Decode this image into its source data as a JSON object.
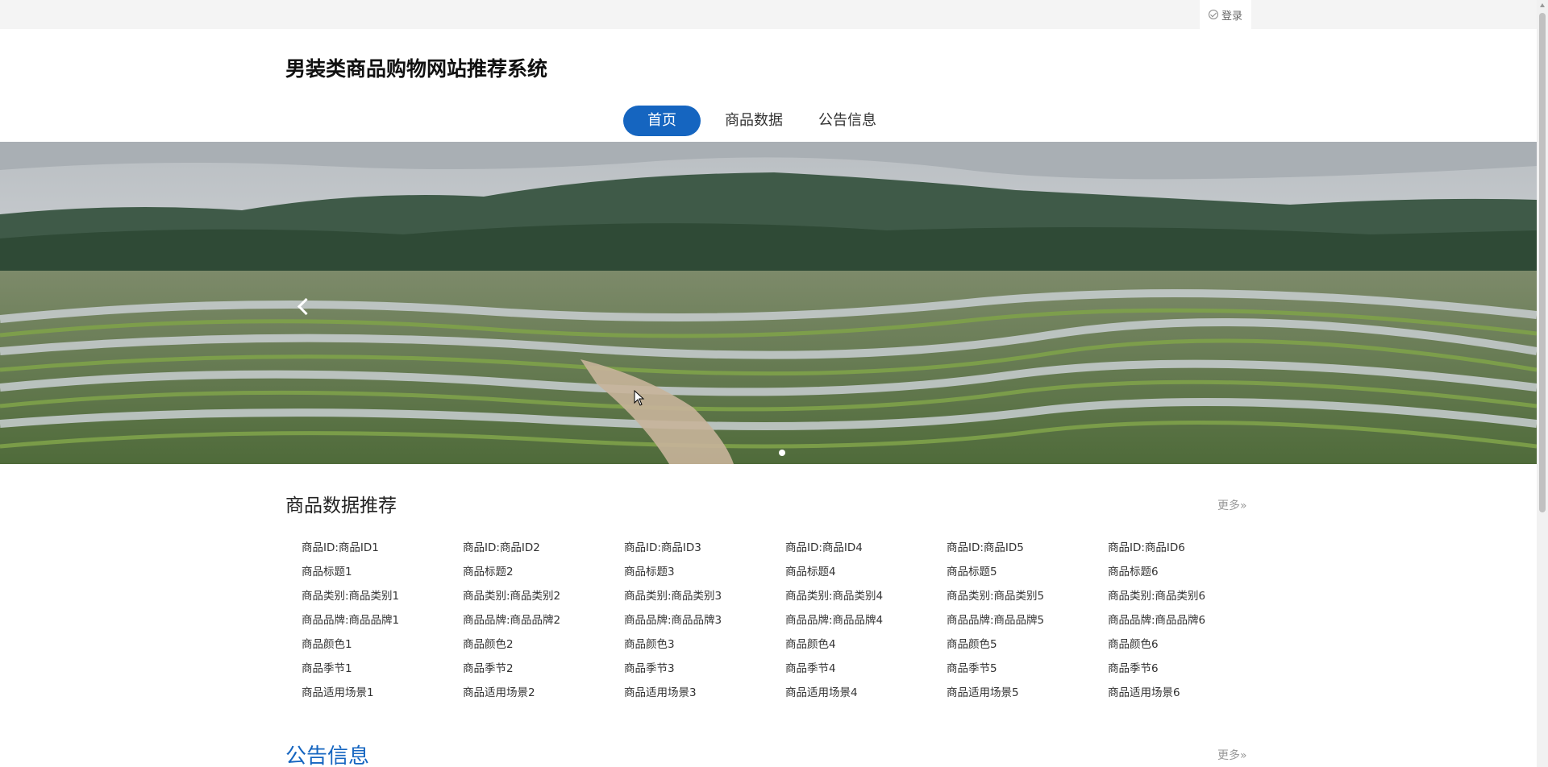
{
  "topbar": {
    "login_label": "登录"
  },
  "site_title": "男装类商品购物网站推荐系统",
  "nav": [
    {
      "label": "首页",
      "active": true
    },
    {
      "label": "商品数据",
      "active": false
    },
    {
      "label": "公告信息",
      "active": false
    }
  ],
  "recommend": {
    "title": "商品数据推荐",
    "more": "更多»",
    "products": [
      {
        "lines": [
          "商品ID:商品ID1",
          "商品标题1",
          "商品类别:商品类别1",
          "商品品牌:商品品牌1",
          "商品颜色1",
          "商品季节1",
          "商品适用场景1"
        ]
      },
      {
        "lines": [
          "商品ID:商品ID2",
          "商品标题2",
          "商品类别:商品类别2",
          "商品品牌:商品品牌2",
          "商品颜色2",
          "商品季节2",
          "商品适用场景2"
        ]
      },
      {
        "lines": [
          "商品ID:商品ID3",
          "商品标题3",
          "商品类别:商品类别3",
          "商品品牌:商品品牌3",
          "商品颜色3",
          "商品季节3",
          "商品适用场景3"
        ]
      },
      {
        "lines": [
          "商品ID:商品ID4",
          "商品标题4",
          "商品类别:商品类别4",
          "商品品牌:商品品牌4",
          "商品颜色4",
          "商品季节4",
          "商品适用场景4"
        ]
      },
      {
        "lines": [
          "商品ID:商品ID5",
          "商品标题5",
          "商品类别:商品类别5",
          "商品品牌:商品品牌5",
          "商品颜色5",
          "商品季节5",
          "商品适用场景5"
        ]
      },
      {
        "lines": [
          "商品ID:商品ID6",
          "商品标题6",
          "商品类别:商品类别6",
          "商品品牌:商品品牌6",
          "商品颜色6",
          "商品季节6",
          "商品适用场景6"
        ]
      }
    ]
  },
  "notice": {
    "title": "公告信息",
    "more": "更多»"
  },
  "colors": {
    "accent": "#1565c0",
    "topbar": "#f4f4f4"
  }
}
